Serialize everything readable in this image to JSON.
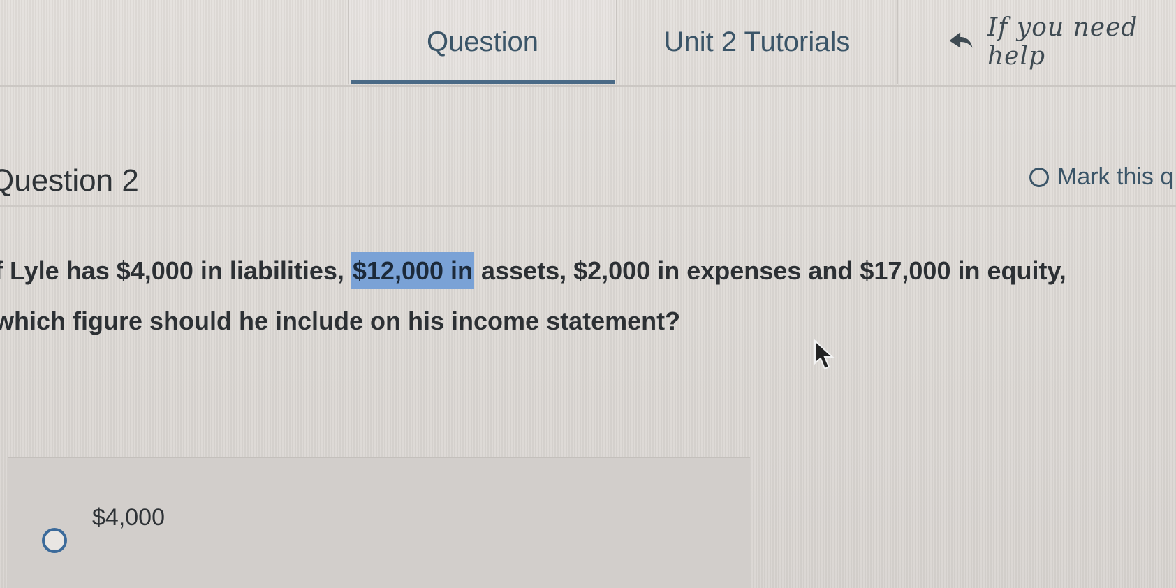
{
  "nav": {
    "tab_question": "Question",
    "tab_tutorials": "Unit 2 Tutorials",
    "help_text": "If you need help"
  },
  "question": {
    "title": "Question 2",
    "mark_label": "Mark this q",
    "text_before": "f Lyle has $4,000 in liabilities, ",
    "text_highlight": "$12,000 in",
    "text_after": " assets, $2,000 in expenses and $17,000 in equity,",
    "text_line2": "which figure should he include on his income statement?"
  },
  "choices": [
    {
      "label": "$4,000",
      "selected": false
    }
  ],
  "colors": {
    "accent": "#3b5568",
    "tab_underline": "#4a6a86",
    "highlight": "#7aa2d6",
    "radio": "#3b6a9a"
  }
}
